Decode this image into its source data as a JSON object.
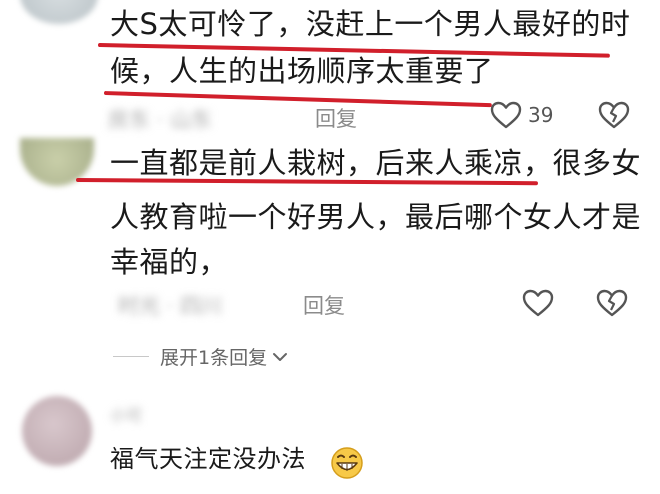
{
  "comments": [
    {
      "text_lines": [
        "大S太可怜了，没赶上一个男人最好的时",
        "候，人生的出场顺序太重要了"
      ],
      "meta_blurred": "房东 · 山东",
      "reply_label": "回复",
      "like_count": "39"
    },
    {
      "text_lines": [
        "一直都是前人栽树，后来人乘凉，很多女",
        "人教育啦一个好男人，最后哪个女人才是",
        "幸福的，"
      ],
      "meta_blurred": "时光 · 四川",
      "reply_label": "回复",
      "like_count": ""
    },
    {
      "meta_blurred": "小可",
      "text": "福气天注定没办法"
    }
  ],
  "expand_replies_label": "展开1条回复",
  "icons": {
    "like": "heart-outline-icon",
    "dislike": "broken-heart-icon",
    "expand": "chevron-down-icon",
    "emoji": "grinning-emoji-icon"
  },
  "colors": {
    "underline": "#d11f2b",
    "meta_text": "#8b8b8b"
  }
}
